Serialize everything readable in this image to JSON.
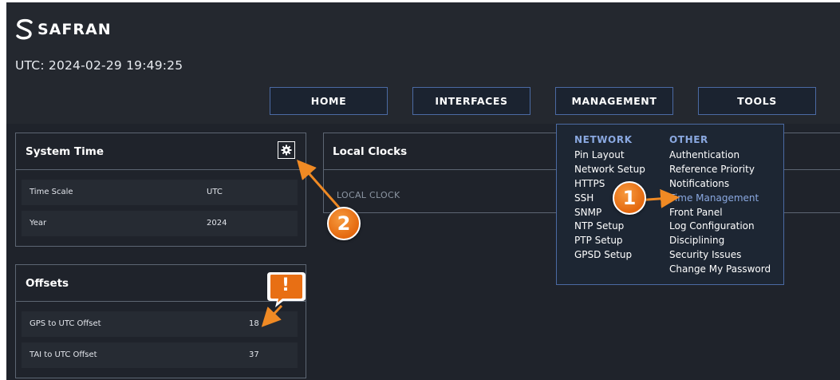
{
  "header": {
    "logo_text": "SAFRAN",
    "utc_time": "UTC: 2024-02-29 19:49:25"
  },
  "nav": {
    "home": "HOME",
    "interfaces": "INTERFACES",
    "management": "MANAGEMENT",
    "tools": "TOOLS"
  },
  "system_time": {
    "title": "System Time",
    "rows": [
      {
        "label": "Time Scale",
        "value": "UTC"
      },
      {
        "label": "Year",
        "value": "2024"
      }
    ]
  },
  "offsets": {
    "title": "Offsets",
    "rows": [
      {
        "label": "GPS to UTC Offset",
        "value": "18"
      },
      {
        "label": "TAI to UTC Offset",
        "value": "37"
      }
    ]
  },
  "local_clocks": {
    "title": "Local Clocks",
    "column_label": "LOCAL CLOCK"
  },
  "management_menu": {
    "network": {
      "title": "NETWORK",
      "items": [
        "Pin Layout",
        "Network Setup",
        "HTTPS",
        "SSH",
        "SNMP",
        "NTP Setup",
        "PTP Setup",
        "GPSD Setup"
      ]
    },
    "other": {
      "title": "OTHER",
      "items": [
        "Authentication",
        "Reference Priority",
        "Notifications",
        "Time Management",
        "Front Panel",
        "Log Configuration",
        "Disciplining",
        "Security Issues",
        "Change My Password"
      ],
      "active_item": "Time Management"
    }
  },
  "annotations": {
    "step1": "1",
    "step2": "2",
    "alert": "!"
  },
  "colors": {
    "background": "#1f232b",
    "accent_border": "#4b6aa3",
    "menu_heading": "#8aa8e0",
    "callout_orange": "#e86f14"
  },
  "icons": {
    "gear": "gear-icon",
    "logo": "safran-s-logo"
  }
}
